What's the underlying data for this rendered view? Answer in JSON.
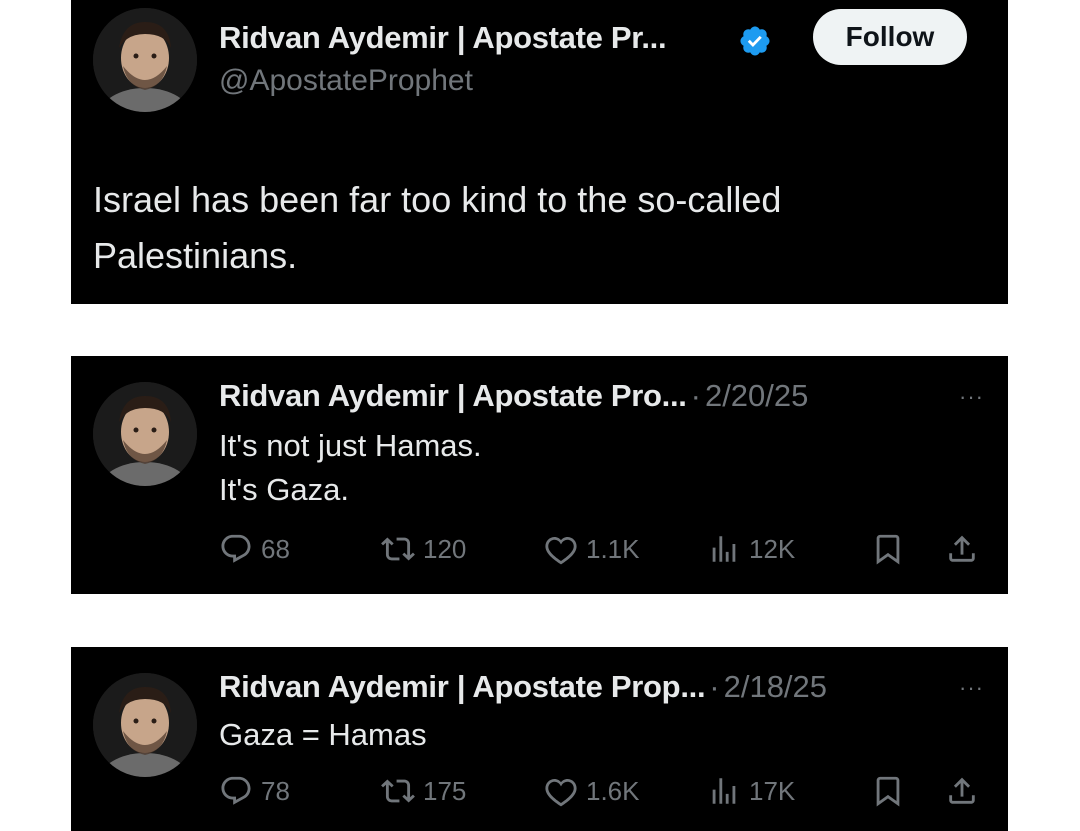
{
  "main_tweet": {
    "display_name": "Ridvan Aydemir | Apostate Pr...",
    "handle": "@ApostateProphet",
    "follow_label": "Follow",
    "verified_icon": "verified-badge-icon",
    "text_line1": "Israel has been far too kind to the so-called",
    "text_line2": "Palestinians."
  },
  "replies": [
    {
      "display_name": "Ridvan Aydemir | Apostate Pro...",
      "separator": "·",
      "date": "2/20/25",
      "more": "···",
      "line1": "It's not just Hamas.",
      "line2": "It's Gaza.",
      "replies": "68",
      "retweets": "120",
      "likes": "1.1K",
      "views": "12K"
    },
    {
      "display_name": "Ridvan Aydemir | Apostate Prop...",
      "separator": "·",
      "date": "2/18/25",
      "more": "···",
      "line1": "Gaza = Hamas",
      "replies": "78",
      "retweets": "175",
      "likes": "1.6K",
      "views": "17K"
    }
  ],
  "colors": {
    "background": "#000000",
    "text": "#e7e9ea",
    "muted": "#71767b",
    "verified": "#1d9bf0",
    "follow_bg": "#eff3f4"
  }
}
